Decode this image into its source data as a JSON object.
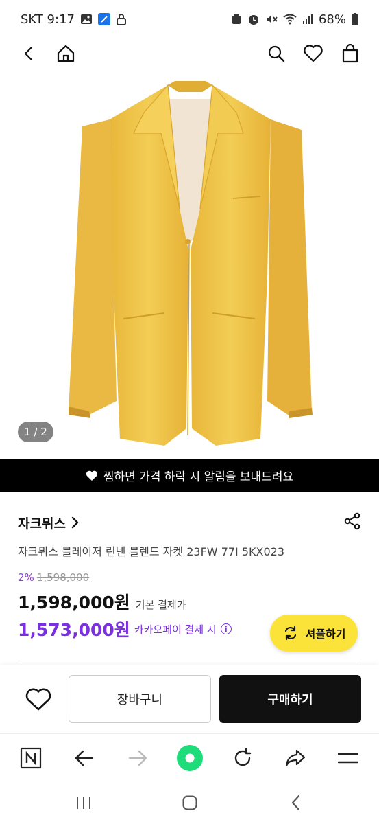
{
  "status_bar": {
    "carrier_time": "SKT 9:17",
    "battery": "68%"
  },
  "top_nav": {
    "icons": [
      "back-icon",
      "home-icon",
      "search-icon",
      "heart-icon",
      "bag-icon"
    ]
  },
  "gallery": {
    "counter": "1 / 2"
  },
  "wishlist_banner": {
    "text": "찜하면 가격 하락 시 알림을 보내드려요"
  },
  "product": {
    "brand": "자크뮈스",
    "title": "자크뮈스 블레이저 린넨 블렌드 자켓 23FW 77I 5KX023",
    "discount_pct": "2%",
    "original_price": "1,598,000",
    "price": "1,598,000원",
    "price_label": "기본 결제가",
    "kakaopay_price": "1,573,000원",
    "kakaopay_label": "카카오페이 결제 시",
    "info_glyph": "i"
  },
  "shuffle_button": {
    "label": "셔플하기"
  },
  "actions": {
    "cart_label": "장바구니",
    "buy_label": "구매하기"
  },
  "colors": {
    "accent_purple": "#7b2fe0",
    "shuffle_yellow": "#fbe33a",
    "jacket_yellow": "#f2c84b"
  }
}
